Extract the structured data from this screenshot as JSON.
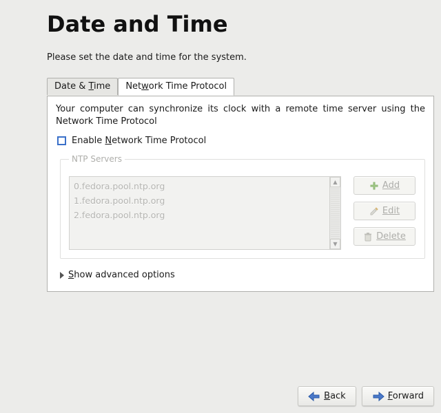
{
  "title": "Date and Time",
  "instruction": "Please set the date and time for the system.",
  "tabs": {
    "datetime": {
      "pre": "Date & ",
      "mn": "T",
      "post": "ime"
    },
    "ntp": {
      "pre": "Net",
      "mn": "w",
      "post": "ork Time Protocol"
    }
  },
  "description": "Your computer can synchronize its clock with a remote time server using the Network Time Protocol",
  "enable": {
    "pre": "Enable ",
    "mn": "N",
    "post": "etwork Time Protocol",
    "checked": false
  },
  "ntp_legend": "NTP Servers",
  "servers": [
    "0.fedora.pool.ntp.org",
    "1.fedora.pool.ntp.org",
    "2.fedora.pool.ntp.org"
  ],
  "buttons": {
    "add": "Add",
    "edit": "Edit",
    "delete": "Delete"
  },
  "advanced": {
    "pre": "",
    "mn": "S",
    "post": "how advanced options"
  },
  "nav": {
    "back": {
      "mn": "B",
      "post": "ack"
    },
    "forward": {
      "mn": "F",
      "post": "orward"
    }
  }
}
